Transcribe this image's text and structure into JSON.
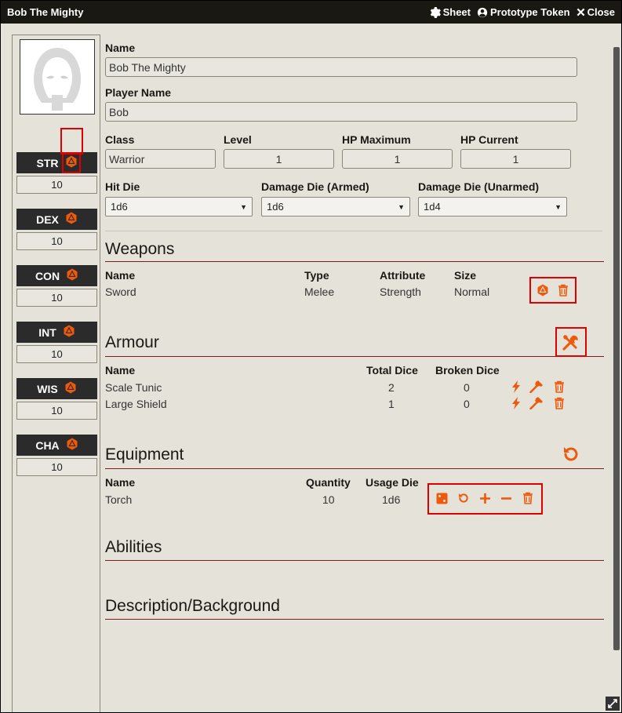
{
  "window": {
    "title": "Bob The Mighty",
    "controls": {
      "sheet_label": "Sheet",
      "prototype_label": "Prototype Token",
      "close_label": "Close"
    }
  },
  "attributes": [
    {
      "abbr": "STR",
      "value": "10"
    },
    {
      "abbr": "DEX",
      "value": "10"
    },
    {
      "abbr": "CON",
      "value": "10"
    },
    {
      "abbr": "INT",
      "value": "10"
    },
    {
      "abbr": "WIS",
      "value": "10"
    },
    {
      "abbr": "CHA",
      "value": "10"
    }
  ],
  "character": {
    "name_label": "Name",
    "name_value": "Bob The Mighty",
    "player_label": "Player Name",
    "player_value": "Bob",
    "class_label": "Class",
    "class_value": "Warrior",
    "level_label": "Level",
    "level_value": "1",
    "hpmax_label": "HP Maximum",
    "hpmax_value": "1",
    "hpcur_label": "HP Current",
    "hpcur_value": "1",
    "hitdie_label": "Hit Die",
    "hitdie_value": "1d6",
    "dmg_armed_label": "Damage Die (Armed)",
    "dmg_armed_value": "1d6",
    "dmg_unarmed_label": "Damage Die (Unarmed)",
    "dmg_unarmed_value": "1d4"
  },
  "weapons": {
    "title": "Weapons",
    "headers": {
      "name": "Name",
      "type": "Type",
      "attribute": "Attribute",
      "size": "Size"
    },
    "rows": [
      {
        "name": "Sword",
        "type": "Melee",
        "attribute": "Strength",
        "size": "Normal"
      }
    ]
  },
  "armour": {
    "title": "Armour",
    "headers": {
      "name": "Name",
      "total": "Total Dice",
      "broken": "Broken Dice"
    },
    "rows": [
      {
        "name": "Scale Tunic",
        "total": "2",
        "broken": "0"
      },
      {
        "name": "Large Shield",
        "total": "1",
        "broken": "0"
      }
    ]
  },
  "equipment": {
    "title": "Equipment",
    "headers": {
      "name": "Name",
      "quantity": "Quantity",
      "usage": "Usage Die"
    },
    "rows": [
      {
        "name": "Torch",
        "quantity": "10",
        "usage": "1d6"
      }
    ]
  },
  "abilities": {
    "title": "Abilities"
  },
  "description": {
    "title": "Description/Background"
  },
  "colors": {
    "accent": "#ee5a0c",
    "rule": "#7a1c1c",
    "highlight": "#e00000"
  }
}
